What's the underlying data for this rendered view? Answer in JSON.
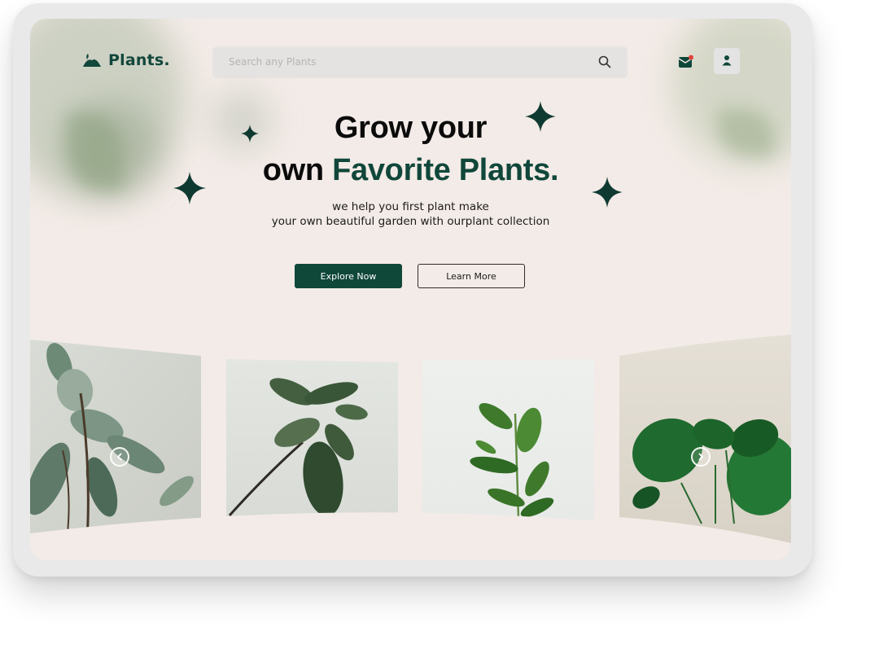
{
  "brand": {
    "name": "Plants.",
    "icon": "plant-sprout-icon",
    "color": "#12473b"
  },
  "search": {
    "placeholder": "Search any Plants",
    "icon": "search-icon"
  },
  "header_actions": [
    {
      "name": "mail",
      "icon": "mail-notification-icon",
      "badge_color": "#e0443a"
    },
    {
      "name": "profile",
      "icon": "user-icon"
    }
  ],
  "hero": {
    "title_line1": "Grow your",
    "title_line2_plain": "own",
    "title_line2_accent": "Favorite Plants.",
    "subtitle_line1": "we help you first plant make",
    "subtitle_line2": "your own beautiful garden with ourplant collection",
    "primary_button": "Explore Now",
    "secondary_button": "Learn More"
  },
  "gallery": {
    "items": [
      {
        "name": "rubber-plant-photo"
      },
      {
        "name": "tropical-plant-branch-photo"
      },
      {
        "name": "potted-ficus-photo"
      },
      {
        "name": "monstera-photo"
      }
    ],
    "prev_icon": "chevron-left-icon",
    "next_icon": "chevron-right-icon"
  },
  "colors": {
    "accent": "#10473a",
    "background": "#f3ebe7",
    "search_bg": "#e5e3e2"
  }
}
